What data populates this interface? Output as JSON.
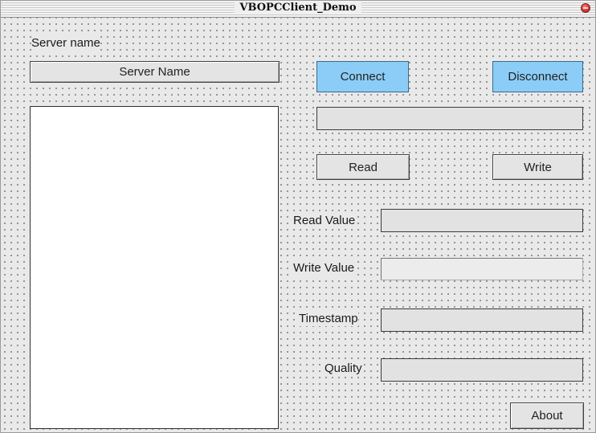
{
  "window": {
    "title": "VBOPCClient_Demo",
    "close_icon": "close-icon"
  },
  "server": {
    "label": "Server name",
    "button_label": "Server Name"
  },
  "server_list": {
    "items": []
  },
  "connection": {
    "connect_label": "Connect",
    "disconnect_label": "Disconnect",
    "status_value": ""
  },
  "actions": {
    "read_label": "Read",
    "write_label": "Write"
  },
  "fields": {
    "read_value_label": "Read Value",
    "read_value": "",
    "write_value_label": "Write Value",
    "write_value": "",
    "timestamp_label": "Timestamp",
    "timestamp_value": "",
    "quality_label": "Quality",
    "quality_value": ""
  },
  "about_label": "About",
  "colors": {
    "highlight_button": "#8ccdf7",
    "form_background": "#e9e9e9",
    "close_button": "#e0403a"
  }
}
